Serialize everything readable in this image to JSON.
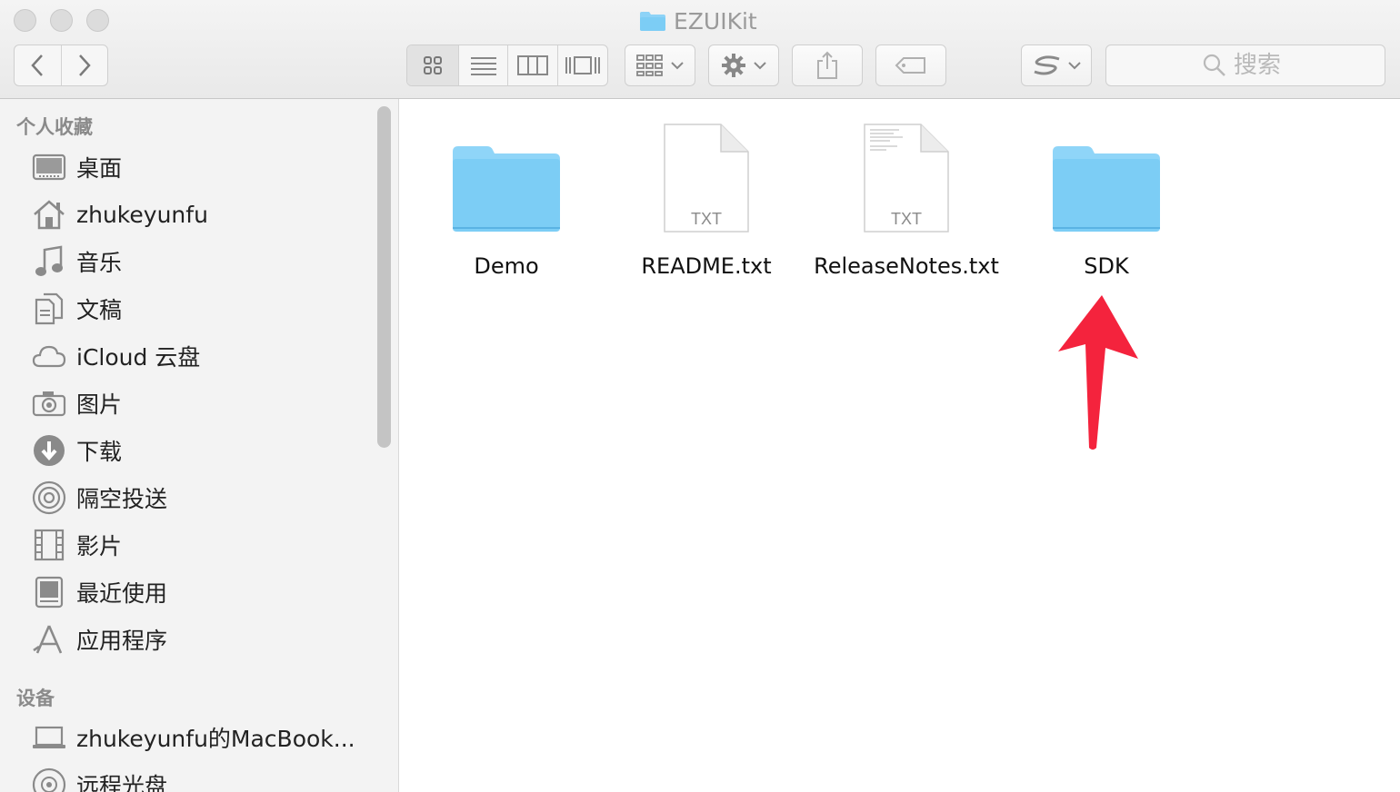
{
  "window": {
    "title": "EZUIKit"
  },
  "toolbar": {
    "search_placeholder": "搜索"
  },
  "sidebar": {
    "favorites_header": "个人收藏",
    "favorites": [
      {
        "label": "桌面",
        "icon": "desktop-icon"
      },
      {
        "label": "zhukeyunfu",
        "icon": "home-icon"
      },
      {
        "label": "音乐",
        "icon": "music-icon"
      },
      {
        "label": "文稿",
        "icon": "documents-icon"
      },
      {
        "label": "iCloud 云盘",
        "icon": "cloud-icon"
      },
      {
        "label": "图片",
        "icon": "camera-icon"
      },
      {
        "label": "下载",
        "icon": "download-icon"
      },
      {
        "label": "隔空投送",
        "icon": "airdrop-icon"
      },
      {
        "label": "影片",
        "icon": "film-icon"
      },
      {
        "label": "最近使用",
        "icon": "recents-icon"
      },
      {
        "label": "应用程序",
        "icon": "applications-icon"
      }
    ],
    "devices_header": "设备",
    "devices": [
      {
        "label": "zhukeyunfu的MacBook...",
        "icon": "laptop-icon"
      },
      {
        "label": "远程光盘",
        "icon": "disc-icon"
      }
    ]
  },
  "files": [
    {
      "name": "Demo",
      "kind": "folder"
    },
    {
      "name": "README.txt",
      "kind": "text",
      "badge": "TXT"
    },
    {
      "name": "ReleaseNotes.txt",
      "kind": "text",
      "badge": "TXT"
    },
    {
      "name": "SDK",
      "kind": "folder"
    }
  ],
  "colors": {
    "folder": "#7ccdf5",
    "arrow": "#f4233d"
  }
}
